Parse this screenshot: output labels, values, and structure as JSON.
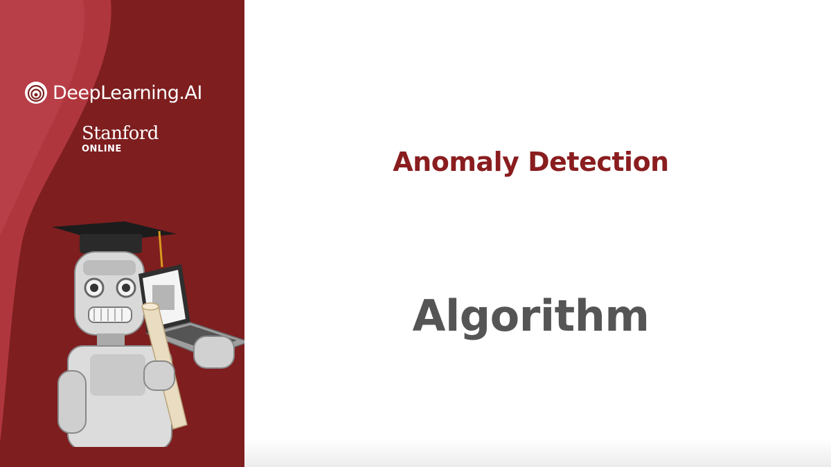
{
  "branding": {
    "logo_text": "DeepLearning.AI",
    "partner_name": "Stanford",
    "partner_sub": "ONLINE"
  },
  "slide": {
    "title": "Anomaly Detection",
    "subtitle": "Algorithm"
  },
  "colors": {
    "sidebar": "#7e1e1f",
    "sidebar_light": "#b0363e",
    "title": "#8a1d1f",
    "subtitle": "#555555"
  },
  "icons": [
    "deeplearning-logo-icon",
    "robot-mascot-illustration"
  ]
}
